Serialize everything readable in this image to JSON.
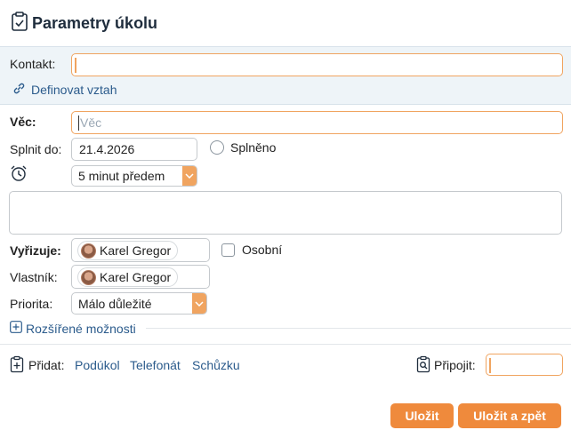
{
  "header": {
    "title": "Parametry úkolu"
  },
  "contact": {
    "label": "Kontakt:",
    "value": "",
    "define_link": "Definovat vztah"
  },
  "subject": {
    "label": "Věc:",
    "placeholder": "Věc",
    "value": ""
  },
  "due": {
    "label": "Splnit do:",
    "value": "21.4.2026",
    "done_label": "Splněno"
  },
  "reminder": {
    "selected": "5 minut předem"
  },
  "notes": {
    "value": ""
  },
  "assignee": {
    "label": "Vyřizuje:",
    "name": "Karel Gregor",
    "private_label": "Osobní"
  },
  "owner": {
    "label": "Vlastník:",
    "name": "Karel Gregor"
  },
  "priority": {
    "label": "Priorita:",
    "selected": "Málo důležité"
  },
  "advanced": {
    "label": "Rozšířené možnosti"
  },
  "add": {
    "label": "Přidat:",
    "links": [
      "Podúkol",
      "Telefonát",
      "Schůzku"
    ]
  },
  "attach": {
    "label": "Připojit:",
    "value": ""
  },
  "footer": {
    "save_label": "Uložit",
    "save_back_label": "Uložit a zpět"
  },
  "colors": {
    "accent": "#ef8a3c",
    "link": "#2b5b8c",
    "band": "#eef4f8"
  }
}
